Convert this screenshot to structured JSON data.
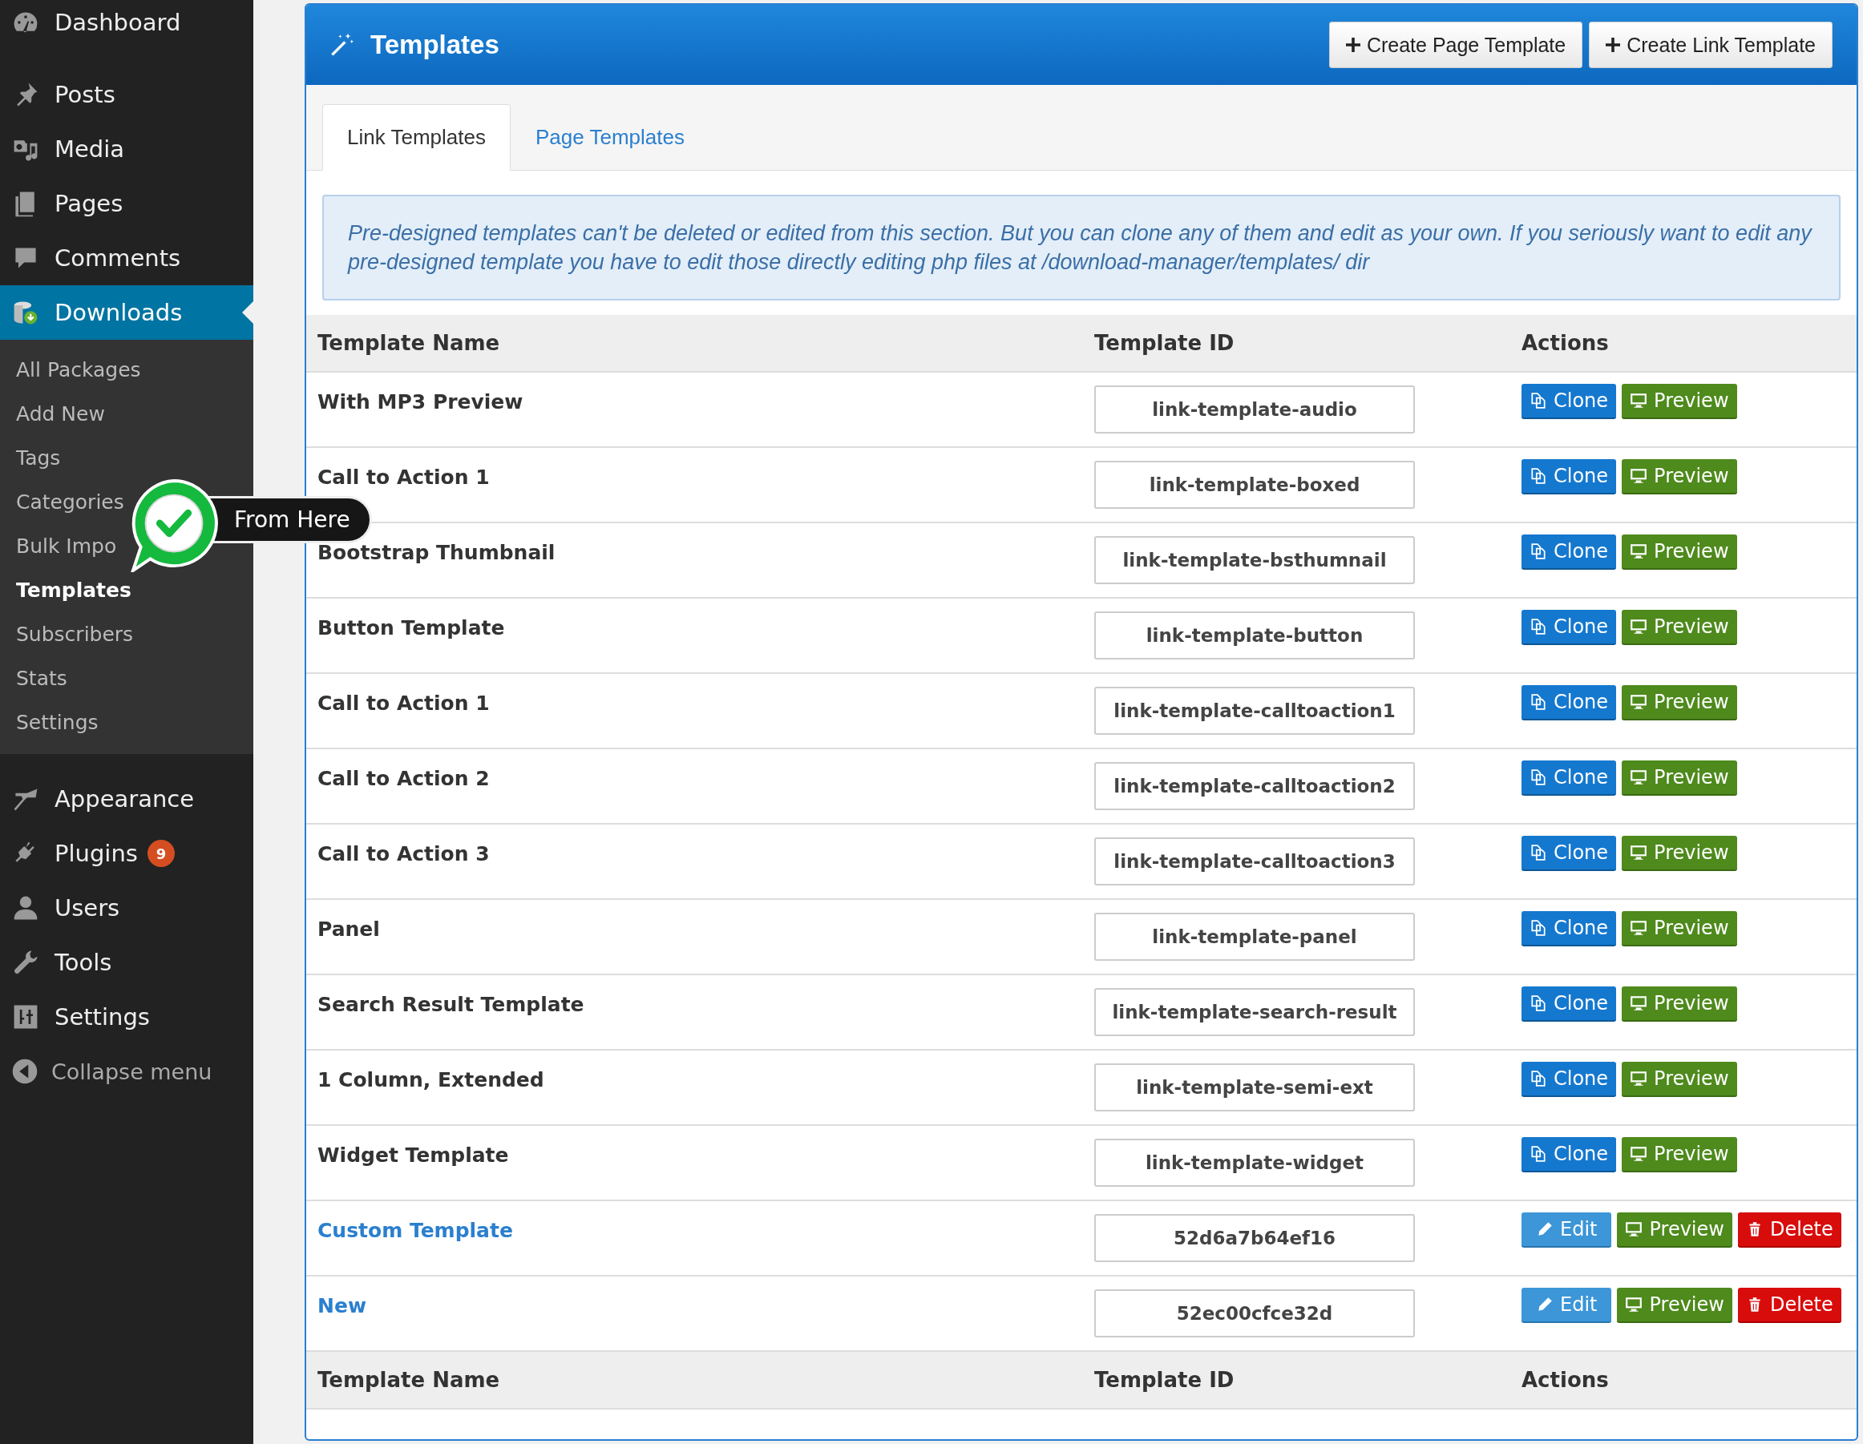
{
  "sidebar": {
    "groups": [
      [
        {
          "label": "Dashboard",
          "selected": false
        }
      ],
      [
        {
          "label": "Posts",
          "selected": false
        },
        {
          "label": "Media",
          "selected": false
        },
        {
          "label": "Pages",
          "selected": false
        },
        {
          "label": "Comments",
          "selected": false
        },
        {
          "label": "Downloads",
          "selected": true,
          "submenu": [
            {
              "label": "All Packages",
              "selected": false
            },
            {
              "label": "Add New",
              "selected": false
            },
            {
              "label": "Tags",
              "selected": false
            },
            {
              "label": "Categories",
              "selected": false
            },
            {
              "label": "Bulk Impo",
              "selected": false
            },
            {
              "label": "Templates",
              "selected": true
            },
            {
              "label": "Subscribers",
              "selected": false
            },
            {
              "label": "Stats",
              "selected": false
            },
            {
              "label": "Settings",
              "selected": false
            }
          ]
        }
      ],
      [
        {
          "label": "Appearance",
          "selected": false
        },
        {
          "label": "Plugins",
          "selected": false,
          "badge": "9"
        },
        {
          "label": "Users",
          "selected": false
        },
        {
          "label": "Tools",
          "selected": false
        },
        {
          "label": "Settings",
          "selected": false
        }
      ]
    ],
    "collapse": "Collapse menu"
  },
  "callout": {
    "text": "From Here"
  },
  "panel": {
    "title": "Templates",
    "header_buttons": [
      "Create Page Template",
      "Create Link Template"
    ],
    "tabs": [
      {
        "label": "Link Templates",
        "selected": true
      },
      {
        "label": "Page Templates",
        "selected": false
      }
    ],
    "notice": "Pre-designed templates can't be deleted or edited from this section. But you can clone any of them and edit as your own. If you seriously want to edit any pre-designed template you have to edit those directly editing php files at /download-manager/templates/ dir",
    "table": {
      "columns": [
        "Template Name",
        "Template ID",
        "Actions"
      ],
      "rows": [
        {
          "name": "With MP3 Preview",
          "kind": "builtin",
          "template_id": "link-template-audio",
          "actions": [
            {
              "kind": "clone",
              "label": "Clone"
            },
            {
              "kind": "preview",
              "label": "Preview"
            }
          ]
        },
        {
          "name": "Call to Action 1",
          "kind": "builtin",
          "template_id": "link-template-boxed",
          "actions": [
            {
              "kind": "clone",
              "label": "Clone"
            },
            {
              "kind": "preview",
              "label": "Preview"
            }
          ]
        },
        {
          "name": "Bootstrap Thumbnail",
          "kind": "builtin",
          "template_id": "link-template-bsthumnail",
          "actions": [
            {
              "kind": "clone",
              "label": "Clone"
            },
            {
              "kind": "preview",
              "label": "Preview"
            }
          ]
        },
        {
          "name": "Button Template",
          "kind": "builtin",
          "template_id": "link-template-button",
          "actions": [
            {
              "kind": "clone",
              "label": "Clone"
            },
            {
              "kind": "preview",
              "label": "Preview"
            }
          ]
        },
        {
          "name": "Call to Action 1",
          "kind": "builtin",
          "template_id": "link-template-calltoaction1",
          "actions": [
            {
              "kind": "clone",
              "label": "Clone"
            },
            {
              "kind": "preview",
              "label": "Preview"
            }
          ]
        },
        {
          "name": "Call to Action 2",
          "kind": "builtin",
          "template_id": "link-template-calltoaction2",
          "actions": [
            {
              "kind": "clone",
              "label": "Clone"
            },
            {
              "kind": "preview",
              "label": "Preview"
            }
          ]
        },
        {
          "name": "Call to Action 3",
          "kind": "builtin",
          "template_id": "link-template-calltoaction3",
          "actions": [
            {
              "kind": "clone",
              "label": "Clone"
            },
            {
              "kind": "preview",
              "label": "Preview"
            }
          ]
        },
        {
          "name": "Panel",
          "kind": "builtin",
          "template_id": "link-template-panel",
          "actions": [
            {
              "kind": "clone",
              "label": "Clone"
            },
            {
              "kind": "preview",
              "label": "Preview"
            }
          ]
        },
        {
          "name": "Search Result Template",
          "kind": "builtin",
          "template_id": "link-template-search-result",
          "actions": [
            {
              "kind": "clone",
              "label": "Clone"
            },
            {
              "kind": "preview",
              "label": "Preview"
            }
          ]
        },
        {
          "name": "1 Column, Extended",
          "kind": "builtin",
          "template_id": "link-template-semi-ext",
          "actions": [
            {
              "kind": "clone",
              "label": "Clone"
            },
            {
              "kind": "preview",
              "label": "Preview"
            }
          ]
        },
        {
          "name": "Widget Template",
          "kind": "builtin",
          "template_id": "link-template-widget",
          "actions": [
            {
              "kind": "clone",
              "label": "Clone"
            },
            {
              "kind": "preview",
              "label": "Preview"
            }
          ]
        },
        {
          "name": "Custom Template",
          "kind": "custom",
          "template_id": "52d6a7b64ef16",
          "actions": [
            {
              "kind": "edit",
              "label": "Edit"
            },
            {
              "kind": "preview",
              "label": "Preview"
            },
            {
              "kind": "delete",
              "label": "Delete"
            }
          ]
        },
        {
          "name": "New",
          "kind": "custom",
          "template_id": "52ec00cfce32d",
          "actions": [
            {
              "kind": "edit",
              "label": "Edit"
            },
            {
              "kind": "preview",
              "label": "Preview"
            },
            {
              "kind": "delete",
              "label": "Delete"
            }
          ]
        }
      ],
      "footer_columns": [
        "Template Name",
        "Template ID",
        "Actions"
      ]
    }
  }
}
